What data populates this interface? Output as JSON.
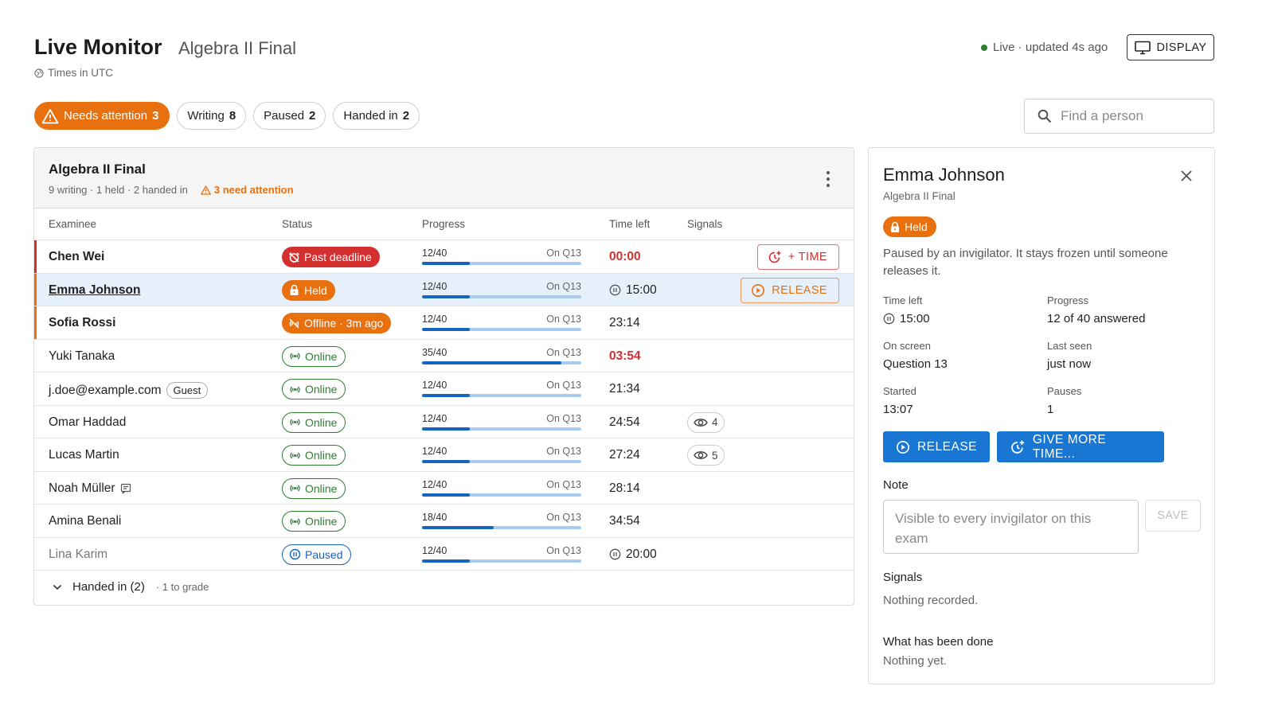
{
  "header": {
    "title": "Live Monitor",
    "exam": "Algebra II Final",
    "timezone": "Times in UTC",
    "live_status": "Live · updated 4s ago",
    "display_label": "DISPLAY"
  },
  "filters": [
    {
      "label": "Needs attention",
      "count": "3",
      "active": true
    },
    {
      "label": "Writing",
      "count": "8"
    },
    {
      "label": "Paused",
      "count": "2"
    },
    {
      "label": "Handed in",
      "count": "2"
    }
  ],
  "search": {
    "placeholder": "Find a person"
  },
  "panel": {
    "title": "Algebra II Final",
    "summary": "9 writing · 1 held · 2 handed in",
    "attention": "3 need attention",
    "columns": {
      "examinee": "Examinee",
      "status": "Status",
      "progress": "Progress",
      "time_left": "Time left",
      "signals": "Signals"
    },
    "handed_in": {
      "label": "Handed in (2)",
      "sub": "· 1 to grade"
    }
  },
  "rows": [
    {
      "name": "Chen Wei",
      "status": "Past deadline",
      "answered": 12,
      "total": 40,
      "progress": "12/40",
      "question": "On Q13",
      "time": "00:00",
      "action": "+ TIME"
    },
    {
      "name": "Emma Johnson",
      "status": "Held",
      "answered": 12,
      "total": 40,
      "progress": "12/40",
      "question": "On Q13",
      "time": "15:00",
      "action": "RELEASE"
    },
    {
      "name": "Sofia Rossi",
      "status": "Offline · 3m ago",
      "answered": 12,
      "total": 40,
      "progress": "12/40",
      "question": "On Q13",
      "time": "23:14"
    },
    {
      "name": "Yuki Tanaka",
      "status": "Online",
      "answered": 35,
      "total": 40,
      "progress": "35/40",
      "question": "On Q13",
      "time": "03:54"
    },
    {
      "name": "j.doe@example.com",
      "tag": "Guest",
      "status": "Online",
      "answered": 12,
      "total": 40,
      "progress": "12/40",
      "question": "On Q13",
      "time": "21:34"
    },
    {
      "name": "Omar Haddad",
      "status": "Online",
      "answered": 12,
      "total": 40,
      "progress": "12/40",
      "question": "On Q13",
      "time": "24:54",
      "signals": "4"
    },
    {
      "name": "Lucas Martin",
      "status": "Online",
      "answered": 12,
      "total": 40,
      "progress": "12/40",
      "question": "On Q13",
      "time": "27:24",
      "signals": "5"
    },
    {
      "name": "Noah Müller",
      "status": "Online",
      "answered": 12,
      "total": 40,
      "progress": "12/40",
      "question": "On Q13",
      "time": "28:14"
    },
    {
      "name": "Amina Benali",
      "status": "Online",
      "answered": 18,
      "total": 40,
      "progress": "18/40",
      "question": "On Q13",
      "time": "34:54"
    },
    {
      "name": "Lina Karim",
      "status": "Paused",
      "answered": 12,
      "total": 40,
      "progress": "12/40",
      "question": "On Q13",
      "time": "20:00"
    }
  ],
  "detail": {
    "name": "Emma Johnson",
    "exam": "Algebra II Final",
    "status": "Held",
    "description": "Paused by an invigilator. It stays frozen until someone releases it.",
    "time_left_label": "Time left",
    "time_left": "15:00",
    "progress_label": "Progress",
    "progress": "12 of 40 answered",
    "on_screen_label": "On screen",
    "on_screen": "Question 13",
    "last_seen_label": "Last seen",
    "last_seen": "just now",
    "started_label": "Started",
    "started": "13:07",
    "pauses_label": "Pauses",
    "pauses": "1",
    "release_label": "RELEASE",
    "more_time_label": "GIVE MORE TIME...",
    "note_label": "Note",
    "note_placeholder": "Visible to every invigilator on this exam",
    "save_label": "SAVE",
    "signals_label": "Signals",
    "signals_value": "Nothing recorded.",
    "done_label": "What has been done",
    "done_value": "Nothing yet."
  },
  "colors": {
    "attention": "#e8700e",
    "danger": "#d32f2f",
    "online": "#2e7d32",
    "primary": "#1976d2",
    "paused": "#1565c0"
  }
}
